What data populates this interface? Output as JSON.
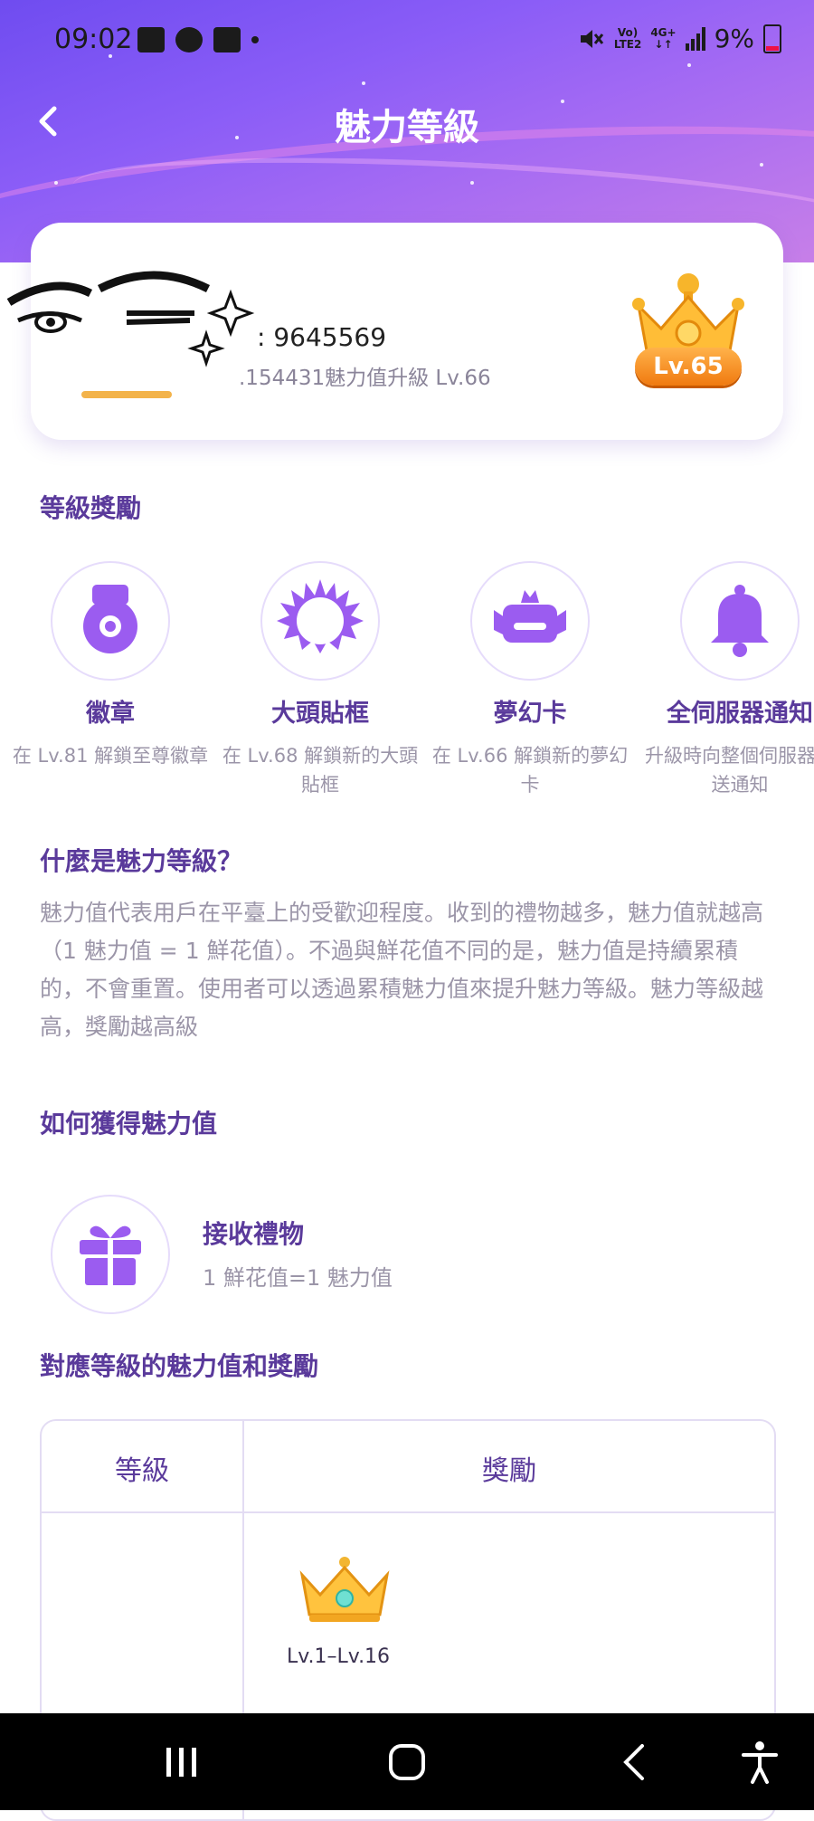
{
  "status_bar": {
    "time": "09:02",
    "volte_top": "Vo)",
    "volte_bottom": "LTE2",
    "network_top": "4G+",
    "network_bottom": "↓↑",
    "battery": "9%"
  },
  "header": {
    "title": "魅力等級"
  },
  "profile": {
    "uid": ": 9645569",
    "progress": ".154431魅力值升級 Lv.66",
    "level_badge": "Lv.65"
  },
  "sections": {
    "rewards_title": "等級獎勵",
    "what_title": "什麼是魅力等級？",
    "what_body": "魅力值代表用戶在平臺上的受歡迎程度。收到的禮物越多，魅力值就越高（1 魅力值 = 1 鮮花值）。不過與鮮花值不同的是，魅力值是持續累積的，不會重置。使用者可以透過累積魅力值來提升魅力等級。魅力等級越高，獎勵越高級",
    "how_title": "如何獲得魅力值",
    "table_title": "對應等級的魅力值和獎勵"
  },
  "rewards": [
    {
      "name": "徽章",
      "desc": "在 Lv.81 解鎖至尊徽章",
      "icon": "medal-icon"
    },
    {
      "name": "大頭貼框",
      "desc": "在 Lv.68 解鎖新的大頭貼框",
      "icon": "avatar-frame-icon"
    },
    {
      "name": "夢幻卡",
      "desc": "在 Lv.66 解鎖新的夢幻卡",
      "icon": "dream-card-icon"
    },
    {
      "name": "全伺服器通知",
      "desc": "升級時向整個伺服器發送通知",
      "icon": "bell-icon"
    }
  ],
  "earn": {
    "title": "接收禮物",
    "subtitle": "1 鮮花值=1 魅力值",
    "icon": "gift-icon"
  },
  "table": {
    "col_level": "等級",
    "col_reward": "獎勵",
    "rows": [
      {
        "level": "",
        "range": "Lv.1–Lv.16",
        "icon": "crown-icon"
      }
    ]
  },
  "colors": {
    "accent": "#8b5df7",
    "title_purple": "#5a3a9b",
    "gray_text": "#9b95a8",
    "badge_orange": "#f39a1e"
  }
}
